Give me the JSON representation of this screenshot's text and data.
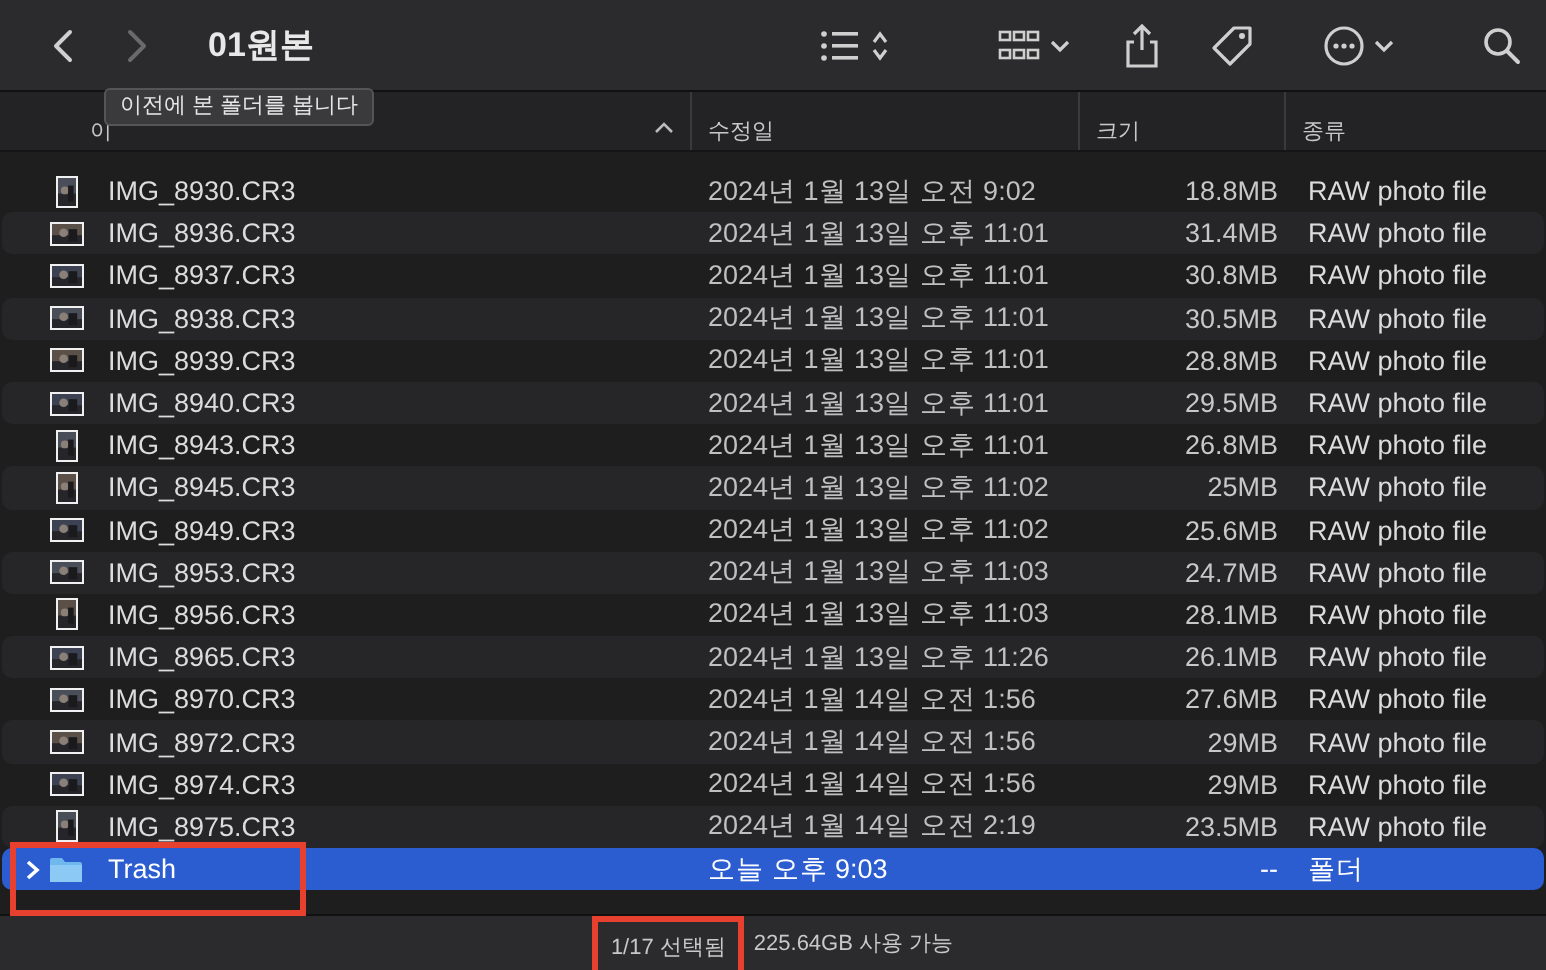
{
  "toolbar": {
    "back": {
      "disabled": false
    },
    "forward": {
      "disabled": true
    },
    "title": "01원본",
    "tooltip": "이전에 본 폴더를 봅니다"
  },
  "columns": [
    {
      "label": "이",
      "sorted": true
    },
    {
      "label": "수정일",
      "sorted": false
    },
    {
      "label": "크기",
      "sorted": false
    },
    {
      "label": "종류",
      "sorted": false
    }
  ],
  "rows": [
    {
      "kind": "portrait",
      "name": "IMG_8930.CR3",
      "modified": "2024년 1월 13일 오전 9:02",
      "size": "18.8MB",
      "file_type": "RAW photo file",
      "selected": false,
      "highlighted": false
    },
    {
      "kind": "landscape",
      "name": "IMG_8936.CR3",
      "modified": "2024년 1월 13일 오후 11:01",
      "size": "31.4MB",
      "file_type": "RAW photo file",
      "selected": false,
      "highlighted": false
    },
    {
      "kind": "landscape",
      "name": "IMG_8937.CR3",
      "modified": "2024년 1월 13일 오후 11:01",
      "size": "30.8MB",
      "file_type": "RAW photo file",
      "selected": false,
      "highlighted": false
    },
    {
      "kind": "landscape",
      "name": "IMG_8938.CR3",
      "modified": "2024년 1월 13일 오후 11:01",
      "size": "30.5MB",
      "file_type": "RAW photo file",
      "selected": false,
      "highlighted": false
    },
    {
      "kind": "landscape",
      "name": "IMG_8939.CR3",
      "modified": "2024년 1월 13일 오후 11:01",
      "size": "28.8MB",
      "file_type": "RAW photo file",
      "selected": false,
      "highlighted": false
    },
    {
      "kind": "landscape",
      "name": "IMG_8940.CR3",
      "modified": "2024년 1월 13일 오후 11:01",
      "size": "29.5MB",
      "file_type": "RAW photo file",
      "selected": false,
      "highlighted": false
    },
    {
      "kind": "portrait",
      "name": "IMG_8943.CR3",
      "modified": "2024년 1월 13일 오후 11:01",
      "size": "26.8MB",
      "file_type": "RAW photo file",
      "selected": false,
      "highlighted": false
    },
    {
      "kind": "portrait",
      "name": "IMG_8945.CR3",
      "modified": "2024년 1월 13일 오후 11:02",
      "size": "25MB",
      "file_type": "RAW photo file",
      "selected": false,
      "highlighted": false
    },
    {
      "kind": "landscape",
      "name": "IMG_8949.CR3",
      "modified": "2024년 1월 13일 오후 11:02",
      "size": "25.6MB",
      "file_type": "RAW photo file",
      "selected": false,
      "highlighted": false
    },
    {
      "kind": "landscape",
      "name": "IMG_8953.CR3",
      "modified": "2024년 1월 13일 오후 11:03",
      "size": "24.7MB",
      "file_type": "RAW photo file",
      "selected": false,
      "highlighted": false
    },
    {
      "kind": "portrait",
      "name": "IMG_8956.CR3",
      "modified": "2024년 1월 13일 오후 11:03",
      "size": "28.1MB",
      "file_type": "RAW photo file",
      "selected": false,
      "highlighted": false
    },
    {
      "kind": "landscape",
      "name": "IMG_8965.CR3",
      "modified": "2024년 1월 13일 오후 11:26",
      "size": "26.1MB",
      "file_type": "RAW photo file",
      "selected": false,
      "highlighted": false
    },
    {
      "kind": "landscape",
      "name": "IMG_8970.CR3",
      "modified": "2024년 1월 14일 오전 1:56",
      "size": "27.6MB",
      "file_type": "RAW photo file",
      "selected": false,
      "highlighted": false
    },
    {
      "kind": "landscape",
      "name": "IMG_8972.CR3",
      "modified": "2024년 1월 14일 오전 1:56",
      "size": "29MB",
      "file_type": "RAW photo file",
      "selected": false,
      "highlighted": false
    },
    {
      "kind": "landscape",
      "name": "IMG_8974.CR3",
      "modified": "2024년 1월 14일 오전 1:56",
      "size": "29MB",
      "file_type": "RAW photo file",
      "selected": false,
      "highlighted": false
    },
    {
      "kind": "portrait",
      "name": "IMG_8975.CR3",
      "modified": "2024년 1월 14일 오전 2:19",
      "size": "23.5MB",
      "file_type": "RAW photo file",
      "selected": false,
      "highlighted": false
    },
    {
      "kind": "folder",
      "name": "Trash",
      "modified": "오늘 오후 9:03",
      "size": "--",
      "file_type": "폴더",
      "selected": true,
      "highlighted": true
    }
  ],
  "status_bar": {
    "selection": "1/17 선택됨",
    "selection_highlighted": true,
    "free_space": "225.64GB 사용 가능"
  }
}
